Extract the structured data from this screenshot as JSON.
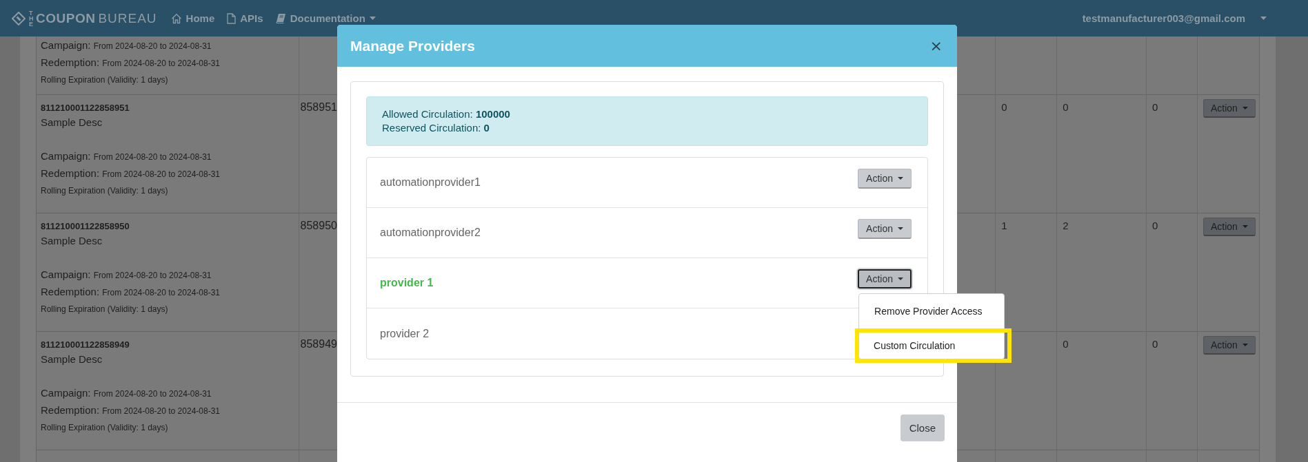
{
  "navbar": {
    "brand": {
      "prefix": "THE",
      "name": "COUPON",
      "suffix": "BUREAU"
    },
    "links": [
      {
        "label": "Home",
        "kind": "home",
        "dropdown": false
      },
      {
        "label": "APIs",
        "kind": "file",
        "dropdown": false
      },
      {
        "label": "Documentation",
        "kind": "book",
        "dropdown": true
      }
    ],
    "user": {
      "email": "testmanufacturer003@gmail.com",
      "dropdown": true
    }
  },
  "table": {
    "rows": [
      {
        "campaign": {
          "label": "Campaign:",
          "value": "From 2024-08-20 to 2024-08-31"
        },
        "redemption": {
          "label": "Redemption:",
          "value": "From 2024-08-20 to 2024-08-31"
        },
        "rolling": "Rolling Expiration (Validity: 1 days)"
      },
      {
        "code": "811210001122858951",
        "description": "Sample Desc",
        "campaign": {
          "label": "Campaign:",
          "value": "From 2024-08-20 to 2024-08-31"
        },
        "redemption": {
          "label": "Redemption:",
          "value": "From 2024-08-20 to 2024-08-31"
        },
        "rolling": "Rolling Expiration (Validity: 1 days)",
        "column_2": "858951",
        "column_3": "0",
        "column_4": "0",
        "column_5": "0",
        "action": "Action"
      },
      {
        "code": "811210001122858950",
        "description": "Sample Desc",
        "campaign": {
          "label": "Campaign:",
          "value": "From 2024-08-20 to 2024-08-31"
        },
        "redemption": {
          "label": "Redemption:",
          "value": "From 2024-08-20 to 2024-08-31"
        },
        "rolling": "Rolling Expiration (Validity: 1 days)",
        "column_2": "858950",
        "column_3": "1",
        "column_4": "2",
        "column_5": "0",
        "action": "Action"
      },
      {
        "code": "811210001122858949",
        "description": "Sample Desc",
        "campaign": {
          "label": "Campaign:",
          "value": "From 2024-08-20 to 2024-08-31"
        },
        "redemption": {
          "label": "Redemption:",
          "value": "From 2024-08-20 to 2024-08-31"
        },
        "rolling": "Rolling Expiration (Validity: 1 days)",
        "column_2": "858949",
        "column_4": "0",
        "column_5": "0",
        "action": "Action"
      },
      {}
    ]
  },
  "modal": {
    "title": "Manage Providers",
    "close": "×",
    "summary": [
      "Allowed Circulation: **100000**",
      "Reserved Circulation: **0**"
    ],
    "providers": [
      {
        "name": "automationprovider1",
        "selected": false,
        "button": "Action",
        "menu_open": false
      },
      {
        "name": "automationprovider2",
        "selected": false,
        "button": "Action",
        "menu_open": false
      },
      {
        "name": "provider 1",
        "selected": true,
        "button": "Action",
        "menu_open": true
      },
      {
        "name": "provider 2",
        "selected": false,
        "menu_open": false
      }
    ],
    "menu": [
      {
        "label": "Remove Provider Access",
        "highlighted": false
      },
      {
        "label": "Custom Circulation",
        "highlighted": true
      }
    ],
    "footer_button": "Close"
  }
}
